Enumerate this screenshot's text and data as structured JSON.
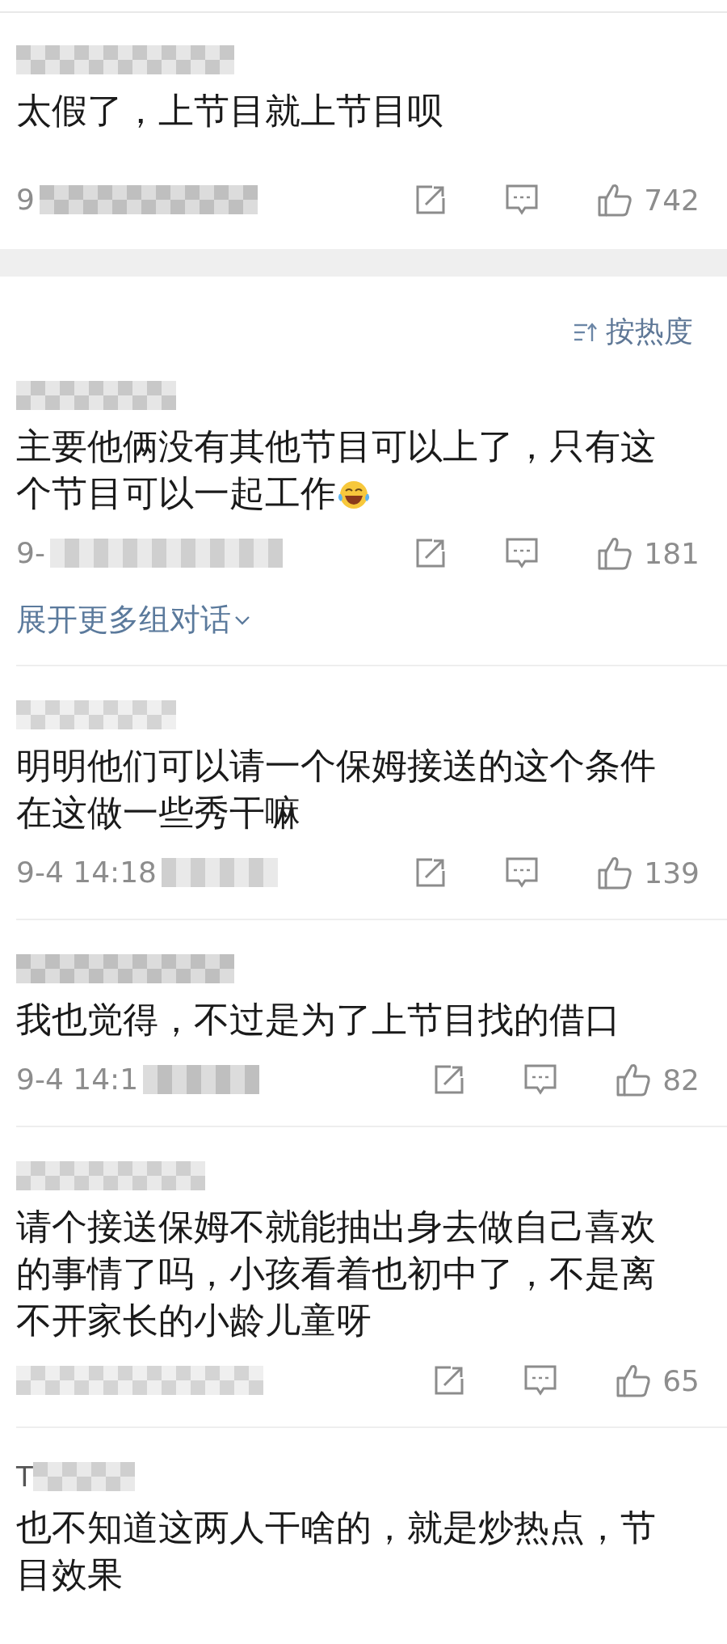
{
  "comments": [
    {
      "text": "太假了，上节目就上节目呗",
      "time": "9",
      "likes": "742"
    },
    {
      "text": "主要他俩没有其他节目可以上了，只有这个节目可以一起工作",
      "emoji": true,
      "time": "9-",
      "likes": "181",
      "expand_link": "展开更多组对话"
    },
    {
      "text": "明明他们可以请一个保姆接送的这个条件在这做一些秀干嘛",
      "time": "9-4 14:18",
      "likes": "139"
    },
    {
      "text": "我也觉得，不过是为了上节目找的借口",
      "time": "9-4 14:1",
      "likes": "82"
    },
    {
      "text": "请个接送保姆不就能抽出身去做自己喜欢的事情了吗，小孩看着也初中了，不是离不开家长的小龄儿童呀",
      "likes": "65"
    },
    {
      "name_prefix": "T",
      "text": "也不知道这两人干啥的，就是炒热点，节目效果"
    }
  ],
  "sort": {
    "label": "按热度"
  }
}
